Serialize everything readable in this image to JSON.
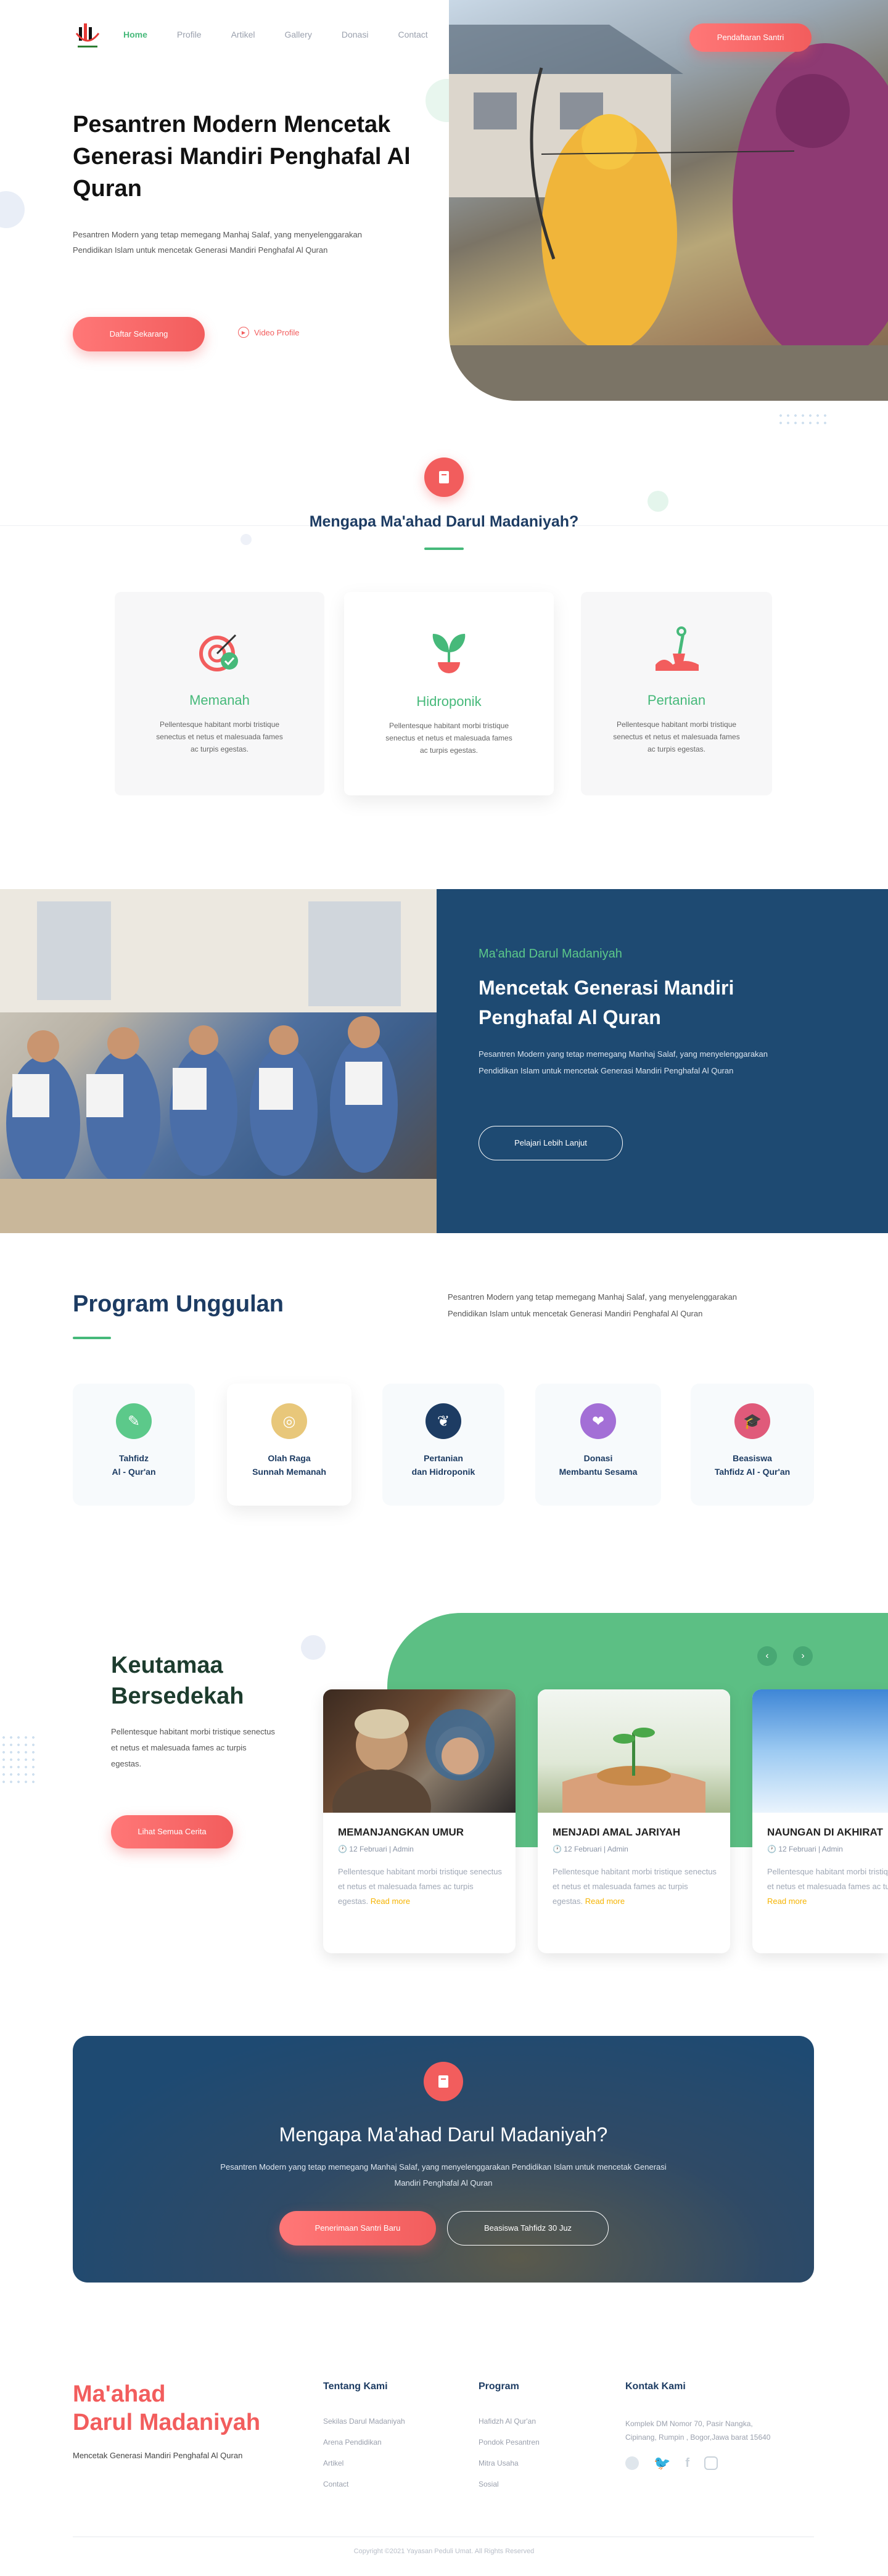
{
  "nav": {
    "items": [
      "Home",
      "Profile",
      "Artikel",
      "Gallery",
      "Donasi",
      "Contact"
    ],
    "cta": "Pendaftaran Santri"
  },
  "hero": {
    "title": "Pesantren Modern Mencetak Generasi Mandiri Penghafal Al Quran",
    "text": "Pesantren Modern yang tetap memegang Manhaj Salaf, yang menyelenggarakan Pendidikan Islam untuk mencetak Generasi Mandiri Penghafal Al Quran",
    "primary": "Daftar Sekarang",
    "video": "Video Profile"
  },
  "why": {
    "title": "Mengapa Ma'ahad Darul Madaniyah?",
    "cards": [
      {
        "title": "Memanah",
        "text": "Pellentesque habitant morbi tristique senectus et netus et malesuada fames ac turpis egestas.",
        "icon": "archery-target-icon"
      },
      {
        "title": "Hidroponik",
        "text": "Pellentesque habitant morbi tristique senectus et netus et malesuada fames ac turpis egestas.",
        "icon": "sprout-icon"
      },
      {
        "title": "Pertanian",
        "text": "Pellentesque habitant morbi tristique senectus et netus et malesuada fames ac turpis egestas.",
        "icon": "shovel-icon"
      }
    ]
  },
  "about": {
    "sub": "Ma'ahad Darul Madaniyah",
    "title": "Mencetak Generasi Mandiri Penghafal Al Quran",
    "text": "Pesantren Modern yang tetap memegang Manhaj Salaf, yang menyelenggarakan Pendidikan Islam untuk mencetak Generasi Mandiri Penghafal Al Quran",
    "btn": "Pelajari Lebih Lanjut"
  },
  "program": {
    "title": "Program Unggulan",
    "text": "Pesantren Modern yang tetap memegang Manhaj Salaf, yang menyelenggarakan Pendidikan Islam untuk mencetak Generasi Mandiri Penghafal Al Quran",
    "items": [
      {
        "label": "Tahfidz\nAl - Qur'an",
        "color": "#5cc98a",
        "icon": "book-icon"
      },
      {
        "label": "Olah Raga\nSunnah Memanah",
        "color": "#e8c77a",
        "icon": "target-icon"
      },
      {
        "label": "Pertanian\ndan Hidroponik",
        "color": "#1d3c63",
        "icon": "plant-icon"
      },
      {
        "label": "Donasi\nMembantu Sesama",
        "color": "#a36fd6",
        "icon": "donate-icon"
      },
      {
        "label": "Beasiswa\nTahfidz Al - Qur'an",
        "color": "#e05a7a",
        "icon": "graduation-icon"
      }
    ]
  },
  "virtue": {
    "title": "Keutamaa Bersedekah",
    "text": "Pellentesque habitant morbi tristique senectus et netus et malesuada fames ac turpis egestas.",
    "btn": "Lihat Semua Cerita",
    "cards": [
      {
        "title": "MEMANJANGKAN UMUR",
        "meta": "12 Februari | Admin",
        "text": "Pellentesque habitant morbi tristique senectus et netus et malesuada fames ac turpis egestas.",
        "more": "Read more"
      },
      {
        "title": "MENJADI AMAL JARIYAH",
        "meta": "12 Februari | Admin",
        "text": "Pellentesque habitant morbi tristique senectus et netus et malesuada fames ac turpis egestas.",
        "more": "Read more"
      },
      {
        "title": "NAUNGAN DI AKHIRAT",
        "meta": "12 Februari | Admin",
        "text": "Pellentesque habitant morbi tristique senectus et netus et malesuada fames ac turpis egestas.",
        "more": "Read more"
      }
    ]
  },
  "cta": {
    "title": "Mengapa Ma'ahad Darul Madaniyah?",
    "text": "Pesantren Modern yang tetap memegang Manhaj Salaf, yang menyelenggarakan Pendidikan Islam untuk mencetak Generasi Mandiri Penghafal Al Quran",
    "btn1": "Penerimaan Santri Baru",
    "btn2": "Beasiswa Tahfidz 30 Juz"
  },
  "footer": {
    "brand1": "Ma'ahad",
    "brand2": "Darul Madaniyah",
    "tagline": "Mencetak Generasi Mandiri Penghafal Al Quran",
    "col1": {
      "title": "Tentang Kami",
      "links": [
        "Sekilas Darul Madaniyah",
        "Arena Pendidikan",
        "Artikel",
        "Contact"
      ]
    },
    "col2": {
      "title": "Program",
      "links": [
        "Hafidzh Al Qur'an",
        "Pondok Pesantren",
        "Mitra Usaha",
        "Sosial"
      ]
    },
    "col3": {
      "title": "Kontak Kami",
      "address": "Komplek DM Nomor 70, Pasir Nangka, Cipinang, Rumpin , Bogor,Jawa barat 15640"
    },
    "copyright": "Copyright ©2021 Yayasan Peduli Umat. All Rights Reserved"
  }
}
